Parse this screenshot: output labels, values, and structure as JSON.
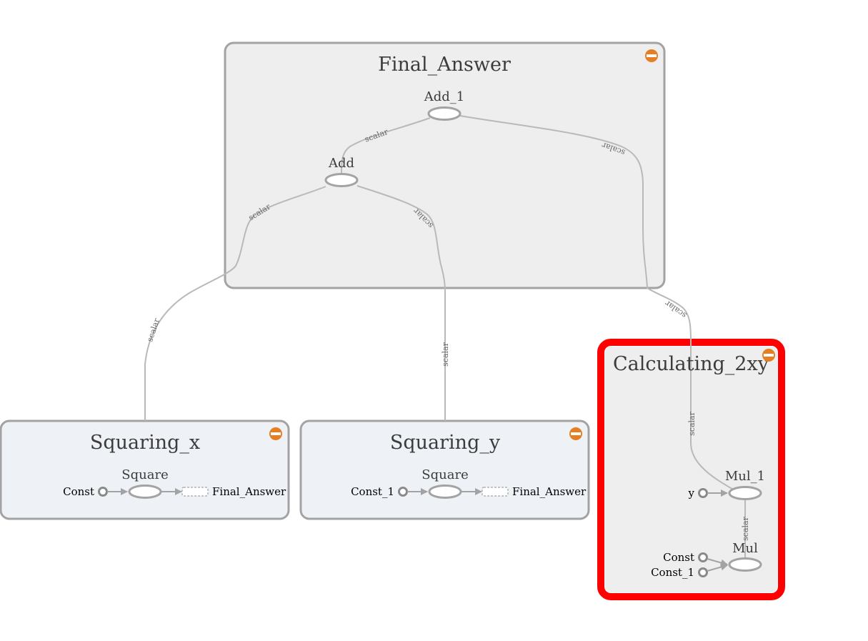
{
  "colors": {
    "group_fill": "#eeeeee",
    "group_fill_blue": "#eef2f7",
    "group_stroke": "#a3a3a3",
    "edge": "#b9b9b9",
    "highlight": "#ff0000",
    "collapse_button": "#e67e22",
    "text": "#3c3c3c"
  },
  "groups": {
    "final_answer": {
      "title": "Final_Answer",
      "nodes": {
        "add_1": "Add_1",
        "add": "Add"
      }
    },
    "squaring_x": {
      "title": "Squaring_x",
      "op": "Square",
      "input": "Const",
      "output_ref": "Final_Answer"
    },
    "squaring_y": {
      "title": "Squaring_y",
      "op": "Square",
      "input": "Const_1",
      "output_ref": "Final_Answer"
    },
    "calculating_2xy": {
      "title": "Calculating_2xy",
      "selected": true,
      "nodes": {
        "mul_1": "Mul_1",
        "mul": "Mul"
      },
      "inputs": {
        "y": "y",
        "const": "Const",
        "const_1": "Const_1"
      }
    }
  },
  "edge_label": "scalar",
  "icons": {
    "collapse": "collapse-minus-icon"
  }
}
